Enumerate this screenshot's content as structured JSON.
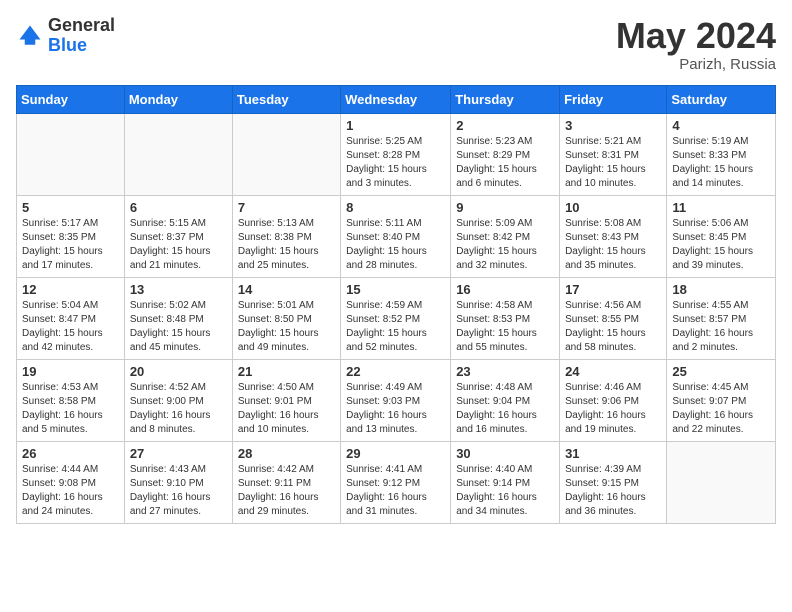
{
  "header": {
    "logo_line1": "General",
    "logo_line2": "Blue",
    "month_year": "May 2024",
    "location": "Parizh, Russia"
  },
  "days_of_week": [
    "Sunday",
    "Monday",
    "Tuesday",
    "Wednesday",
    "Thursday",
    "Friday",
    "Saturday"
  ],
  "weeks": [
    [
      {
        "day": "",
        "info": ""
      },
      {
        "day": "",
        "info": ""
      },
      {
        "day": "",
        "info": ""
      },
      {
        "day": "1",
        "info": "Sunrise: 5:25 AM\nSunset: 8:28 PM\nDaylight: 15 hours and 3 minutes."
      },
      {
        "day": "2",
        "info": "Sunrise: 5:23 AM\nSunset: 8:29 PM\nDaylight: 15 hours and 6 minutes."
      },
      {
        "day": "3",
        "info": "Sunrise: 5:21 AM\nSunset: 8:31 PM\nDaylight: 15 hours and 10 minutes."
      },
      {
        "day": "4",
        "info": "Sunrise: 5:19 AM\nSunset: 8:33 PM\nDaylight: 15 hours and 14 minutes."
      }
    ],
    [
      {
        "day": "5",
        "info": "Sunrise: 5:17 AM\nSunset: 8:35 PM\nDaylight: 15 hours and 17 minutes."
      },
      {
        "day": "6",
        "info": "Sunrise: 5:15 AM\nSunset: 8:37 PM\nDaylight: 15 hours and 21 minutes."
      },
      {
        "day": "7",
        "info": "Sunrise: 5:13 AM\nSunset: 8:38 PM\nDaylight: 15 hours and 25 minutes."
      },
      {
        "day": "8",
        "info": "Sunrise: 5:11 AM\nSunset: 8:40 PM\nDaylight: 15 hours and 28 minutes."
      },
      {
        "day": "9",
        "info": "Sunrise: 5:09 AM\nSunset: 8:42 PM\nDaylight: 15 hours and 32 minutes."
      },
      {
        "day": "10",
        "info": "Sunrise: 5:08 AM\nSunset: 8:43 PM\nDaylight: 15 hours and 35 minutes."
      },
      {
        "day": "11",
        "info": "Sunrise: 5:06 AM\nSunset: 8:45 PM\nDaylight: 15 hours and 39 minutes."
      }
    ],
    [
      {
        "day": "12",
        "info": "Sunrise: 5:04 AM\nSunset: 8:47 PM\nDaylight: 15 hours and 42 minutes."
      },
      {
        "day": "13",
        "info": "Sunrise: 5:02 AM\nSunset: 8:48 PM\nDaylight: 15 hours and 45 minutes."
      },
      {
        "day": "14",
        "info": "Sunrise: 5:01 AM\nSunset: 8:50 PM\nDaylight: 15 hours and 49 minutes."
      },
      {
        "day": "15",
        "info": "Sunrise: 4:59 AM\nSunset: 8:52 PM\nDaylight: 15 hours and 52 minutes."
      },
      {
        "day": "16",
        "info": "Sunrise: 4:58 AM\nSunset: 8:53 PM\nDaylight: 15 hours and 55 minutes."
      },
      {
        "day": "17",
        "info": "Sunrise: 4:56 AM\nSunset: 8:55 PM\nDaylight: 15 hours and 58 minutes."
      },
      {
        "day": "18",
        "info": "Sunrise: 4:55 AM\nSunset: 8:57 PM\nDaylight: 16 hours and 2 minutes."
      }
    ],
    [
      {
        "day": "19",
        "info": "Sunrise: 4:53 AM\nSunset: 8:58 PM\nDaylight: 16 hours and 5 minutes."
      },
      {
        "day": "20",
        "info": "Sunrise: 4:52 AM\nSunset: 9:00 PM\nDaylight: 16 hours and 8 minutes."
      },
      {
        "day": "21",
        "info": "Sunrise: 4:50 AM\nSunset: 9:01 PM\nDaylight: 16 hours and 10 minutes."
      },
      {
        "day": "22",
        "info": "Sunrise: 4:49 AM\nSunset: 9:03 PM\nDaylight: 16 hours and 13 minutes."
      },
      {
        "day": "23",
        "info": "Sunrise: 4:48 AM\nSunset: 9:04 PM\nDaylight: 16 hours and 16 minutes."
      },
      {
        "day": "24",
        "info": "Sunrise: 4:46 AM\nSunset: 9:06 PM\nDaylight: 16 hours and 19 minutes."
      },
      {
        "day": "25",
        "info": "Sunrise: 4:45 AM\nSunset: 9:07 PM\nDaylight: 16 hours and 22 minutes."
      }
    ],
    [
      {
        "day": "26",
        "info": "Sunrise: 4:44 AM\nSunset: 9:08 PM\nDaylight: 16 hours and 24 minutes."
      },
      {
        "day": "27",
        "info": "Sunrise: 4:43 AM\nSunset: 9:10 PM\nDaylight: 16 hours and 27 minutes."
      },
      {
        "day": "28",
        "info": "Sunrise: 4:42 AM\nSunset: 9:11 PM\nDaylight: 16 hours and 29 minutes."
      },
      {
        "day": "29",
        "info": "Sunrise: 4:41 AM\nSunset: 9:12 PM\nDaylight: 16 hours and 31 minutes."
      },
      {
        "day": "30",
        "info": "Sunrise: 4:40 AM\nSunset: 9:14 PM\nDaylight: 16 hours and 34 minutes."
      },
      {
        "day": "31",
        "info": "Sunrise: 4:39 AM\nSunset: 9:15 PM\nDaylight: 16 hours and 36 minutes."
      },
      {
        "day": "",
        "info": ""
      }
    ]
  ]
}
